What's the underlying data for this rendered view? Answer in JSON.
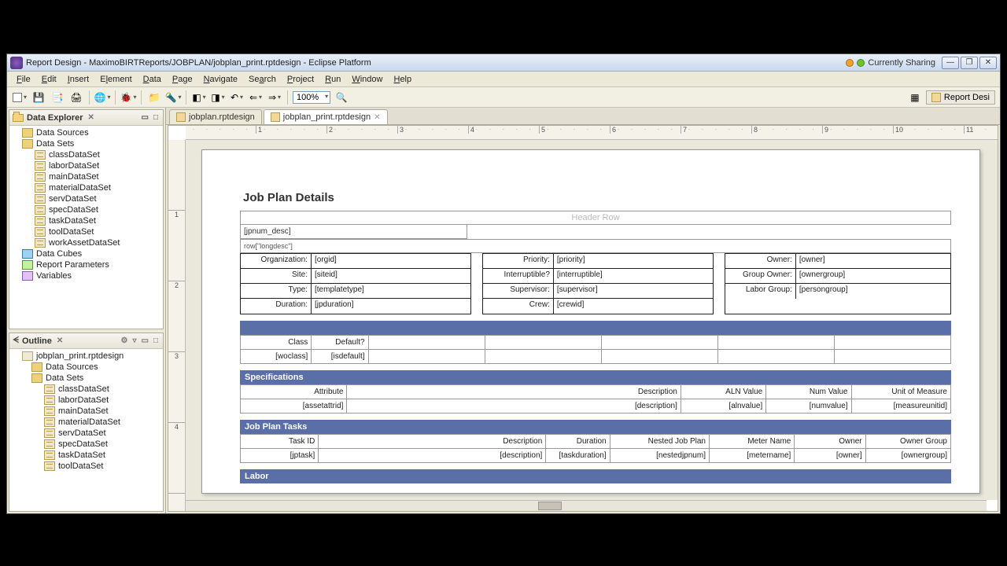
{
  "window": {
    "title": "Report Design - MaximoBIRTReports/JOBPLAN/jobplan_print.rptdesign - Eclipse Platform",
    "sharing": "Currently Sharing"
  },
  "menu": [
    "File",
    "Edit",
    "Insert",
    "Element",
    "Data",
    "Page",
    "Navigate",
    "Search",
    "Project",
    "Run",
    "Window",
    "Help"
  ],
  "zoom": "100%",
  "perspective": "Report Desi",
  "dataExplorer": {
    "title": "Data Explorer",
    "nodes": {
      "sources": "Data Sources",
      "sets": "Data Sets",
      "setItems": [
        "classDataSet",
        "laborDataSet",
        "mainDataSet",
        "materialDataSet",
        "servDataSet",
        "specDataSet",
        "taskDataSet",
        "toolDataSet",
        "workAssetDataSet"
      ],
      "cubes": "Data Cubes",
      "params": "Report Parameters",
      "vars": "Variables"
    }
  },
  "outline": {
    "title": "Outline",
    "root": "jobplan_print.rptdesign",
    "nodes": {
      "sources": "Data Sources",
      "sets": "Data Sets",
      "setItems": [
        "classDataSet",
        "laborDataSet",
        "mainDataSet",
        "materialDataSet",
        "servDataSet",
        "specDataSet",
        "taskDataSet",
        "toolDataSet"
      ]
    }
  },
  "tabs": [
    {
      "label": "jobplan.rptdesign",
      "active": false
    },
    {
      "label": "jobplan_print.rptdesign",
      "active": true
    }
  ],
  "report": {
    "title": "Job Plan Details",
    "headerRow": "Header Row",
    "jpnum": "[jpnum_desc]",
    "longdesc": "row[\"longdesc\"]",
    "col1": [
      {
        "label": "Organization:",
        "value": "[orgid]"
      },
      {
        "label": "Site:",
        "value": "[siteid]"
      },
      {
        "label": "Type:",
        "value": "[templatetype]"
      },
      {
        "label": "Duration:",
        "value": "[jpduration]"
      }
    ],
    "col2": [
      {
        "label": "Priority:",
        "value": "[priority]"
      },
      {
        "label": "Interruptible?",
        "value": "[interruptible]"
      },
      {
        "label": "Supervisor:",
        "value": "[supervisor]"
      },
      {
        "label": "Crew:",
        "value": "[crewid]"
      }
    ],
    "col3": [
      {
        "label": "Owner:",
        "value": "[owner]"
      },
      {
        "label": "Group Owner:",
        "value": "[ownergroup]"
      },
      {
        "label": "Labor Group:",
        "value": "[persongroup]"
      }
    ],
    "classHeader": [
      "Class",
      "Default?"
    ],
    "classRow": [
      "[woclass]",
      "[isdefault]"
    ],
    "specTitle": "Specifications",
    "specHeader": [
      "Attribute",
      "Description",
      "ALN Value",
      "Num Value",
      "Unit of Measure"
    ],
    "specRow": [
      "[assetattrid]",
      "[description]",
      "[alnvalue]",
      "[numvalue]",
      "[measureunitid]"
    ],
    "tasksTitle": "Job Plan Tasks",
    "tasksHeader": [
      "Task ID",
      "Description",
      "Duration",
      "Nested Job Plan",
      "Meter Name",
      "Owner",
      "Owner Group"
    ],
    "tasksRow": [
      "[jptask]",
      "[description]",
      "[taskduration]",
      "[nestedjpnum]",
      "[metername]",
      "[owner]",
      "[ownergroup]"
    ],
    "laborTitle": "Labor"
  }
}
